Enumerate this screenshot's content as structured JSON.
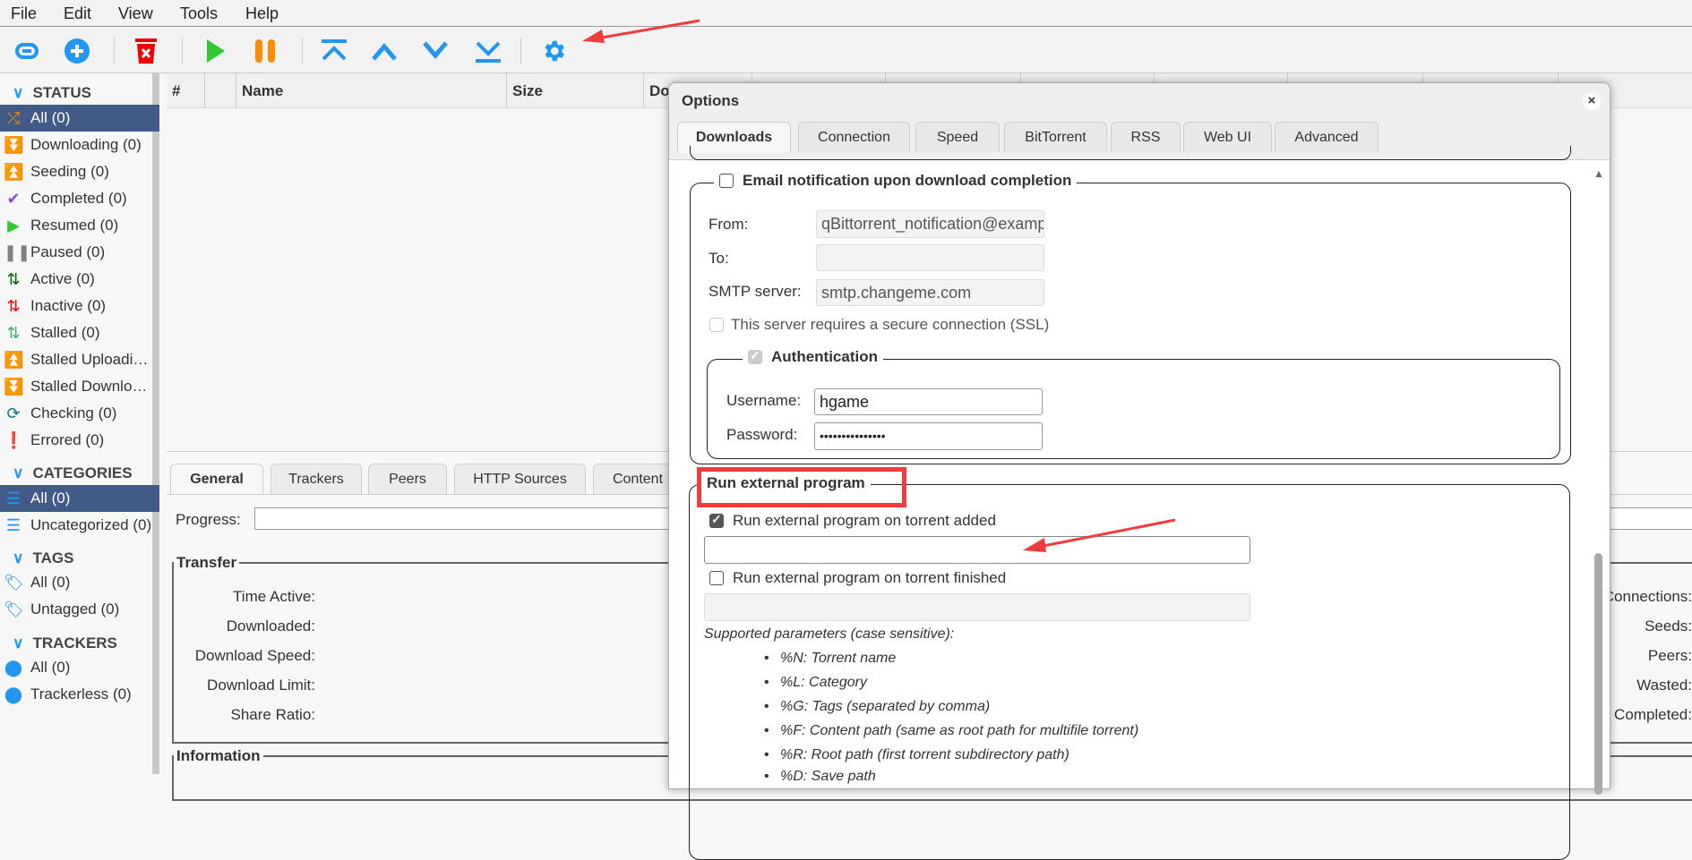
{
  "menu": [
    "File",
    "Edit",
    "View",
    "Tools",
    "Help"
  ],
  "toolbar": {
    "icons": [
      "link-icon",
      "add-icon",
      "delete-icon",
      "resume-icon",
      "pause-icon",
      "move-top-icon",
      "move-up-icon",
      "move-down-icon",
      "move-bottom-icon",
      "options-gear-icon"
    ]
  },
  "sidebar": {
    "status_header": "STATUS",
    "status": [
      {
        "label": "All (0)",
        "icon": "shuffle-icon",
        "color": "#ff8c00"
      },
      {
        "label": "Downloading (0)",
        "icon": "double-chevron-down-icon",
        "color": "#006400"
      },
      {
        "label": "Seeding (0)",
        "icon": "double-chevron-up-icon",
        "color": "#4169e1"
      },
      {
        "label": "Completed (0)",
        "icon": "check-icon",
        "color": "#8a4fe0"
      },
      {
        "label": "Resumed (0)",
        "icon": "play-icon",
        "color": "#32c832"
      },
      {
        "label": "Paused (0)",
        "icon": "pause-icon",
        "color": "#808080"
      },
      {
        "label": "Active (0)",
        "icon": "up-down-arrows-icon",
        "color": "#006400"
      },
      {
        "label": "Inactive (0)",
        "icon": "up-down-arrows-icon",
        "color": "#ff0000"
      },
      {
        "label": "Stalled (0)",
        "icon": "up-down-arrows-icon",
        "color": "#3cb371"
      },
      {
        "label": "Stalled Uploadi…",
        "icon": "double-chevron-up-icon",
        "color": "#6495ed"
      },
      {
        "label": "Stalled Downlo…",
        "icon": "double-chevron-down-icon",
        "color": "#3cb371"
      },
      {
        "label": "Checking (0)",
        "icon": "refresh-icon",
        "color": "#008080"
      },
      {
        "label": "Errored (0)",
        "icon": "error-icon",
        "color": "#ff0000"
      }
    ],
    "categories_header": "CATEGORIES",
    "categories": [
      "All (0)",
      "Uncategorized (0)"
    ],
    "tags_header": "TAGS",
    "tags": [
      "All (0)",
      "Untagged (0)"
    ],
    "trackers_header": "TRACKERS",
    "trackers": [
      "All (0)",
      "Trackerless (0)"
    ]
  },
  "table": {
    "columns": [
      "#",
      "",
      "Name",
      "Size",
      "Done"
    ]
  },
  "properties": {
    "tabs": [
      "General",
      "Trackers",
      "Peers",
      "HTTP Sources",
      "Content"
    ],
    "progress_label": "Progress:",
    "transfer_legend": "Transfer",
    "transfer_labels": [
      "Time Active:",
      "Downloaded:",
      "Download Speed:",
      "Download Limit:",
      "Share Ratio:"
    ],
    "right_labels": [
      "Connections:",
      "Seeds:",
      "Peers:",
      "Wasted:",
      "en Completed:"
    ],
    "information_legend": "Information"
  },
  "dialog": {
    "title": "Options",
    "close": "×",
    "tabs": [
      "Downloads",
      "Connection",
      "Speed",
      "BitTorrent",
      "RSS",
      "Web UI",
      "Advanced"
    ],
    "active_tab": "Downloads",
    "email": {
      "legend": "Email notification upon download completion",
      "enabled": false,
      "from_label": "From:",
      "from_value": "qBittorrent_notification@example.com",
      "to_label": "To:",
      "to_value": "",
      "smtp_label": "SMTP server:",
      "smtp_value": "smtp.changeme.com",
      "ssl_label": "This server requires a secure connection (SSL)",
      "auth_legend": "Authentication",
      "username_label": "Username:",
      "username_value": "hgame",
      "password_label": "Password:",
      "password_value": "•••••••••••••••"
    },
    "external": {
      "legend": "Run external program",
      "added_label": "Run external program on torrent added",
      "added_checked": true,
      "added_value": "",
      "finished_label": "Run external program on torrent finished",
      "finished_checked": false,
      "finished_value": "",
      "params_title": "Supported parameters (case sensitive):",
      "params": [
        "%N: Torrent name",
        "%L: Category",
        "%G: Tags (separated by comma)",
        "%F: Content path (same as root path for multifile torrent)",
        "%R: Root path (first torrent subdirectory path)",
        "%D: Save path"
      ]
    }
  },
  "colors": {
    "accent": "#2196f3",
    "selected": "#415a87",
    "annotation": "#f03c3c"
  }
}
